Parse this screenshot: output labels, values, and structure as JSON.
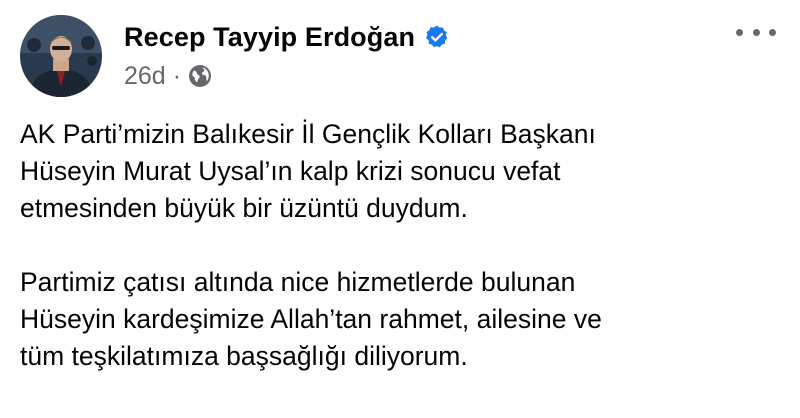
{
  "author": {
    "name": "Recep Tayyip Erdoğan",
    "verified": true
  },
  "timestamp": "26d",
  "separator": "·",
  "audience_icon": "globe-icon",
  "more_icon": "more-options-icon",
  "post": {
    "paragraph_1": "AK Parti’mizin Balıkesir İl Gençlik Kolları Başkanı\nHüseyin Murat Uysal’ın kalp krizi sonucu vefat\netmesinden büyük bir üzüntü duydum.",
    "paragraph_2": "Partimiz çatısı altında nice hizmetlerde bulunan\nHüseyin kardeşimize Allah’tan rahmet, ailesine ve\ntüm teşkilatımıza başsağlığı diliyorum."
  },
  "colors": {
    "verified_badge": "#1877f2",
    "secondary_text": "#65676b",
    "primary_text": "#050505"
  }
}
